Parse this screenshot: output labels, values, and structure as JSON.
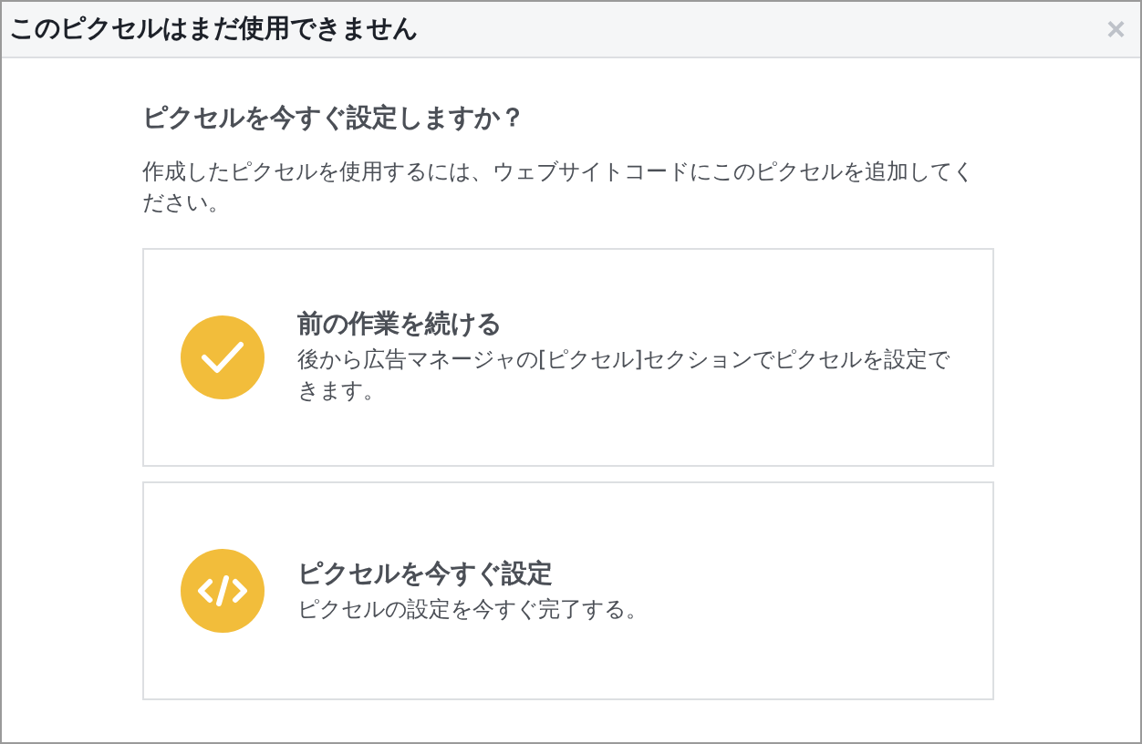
{
  "window": {
    "title": "このピクセルはまだ使用できません",
    "close": "×"
  },
  "heading": "ピクセルを今すぐ設定しますか？",
  "description": "作成したピクセルを使用するには、ウェブサイトコードにこのピクセルを追加してください。",
  "options": [
    {
      "kind": "check",
      "title": "前の作業を続ける",
      "text": "後から広告マネージャの[ピクセル]セクションでピクセルを設定できます。"
    },
    {
      "kind": "code",
      "title": "ピクセルを今すぐ設定",
      "text": "ピクセルの設定を今すぐ完了する。"
    }
  ]
}
